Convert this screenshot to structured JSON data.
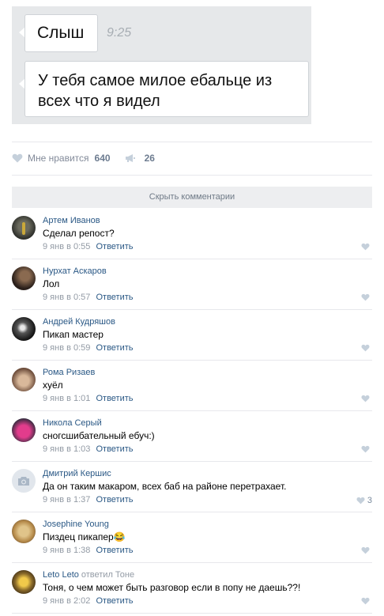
{
  "chat": {
    "message1": "Слыш",
    "time": "9:25",
    "message2_line1": "У тебя самое милое ебальце из",
    "message2_line2": "всех что я видел"
  },
  "post_actions": {
    "like_label": "Мне нравится",
    "like_count": "640",
    "share_count": "26"
  },
  "hide_comments_label": "Скрыть комментарии",
  "reply_label": "Ответить",
  "comments": [
    {
      "author": "Артем Иванов",
      "text": "Сделал репост?",
      "date": "9 янв в 0:55",
      "likes": ""
    },
    {
      "author": "Нурхат Аскаров",
      "text": "Лол",
      "date": "9 янв в 0:57",
      "likes": ""
    },
    {
      "author": "Андрей Кудряшов",
      "text": "Пикап мастер",
      "date": "9 янв в 0:59",
      "likes": ""
    },
    {
      "author": "Рома Ризаев",
      "text": "хуёл",
      "date": "9 янв в 1:01",
      "likes": ""
    },
    {
      "author": "Никола Серый",
      "text": "сногсшибательный ебуч:)",
      "date": "9 янв в 1:03",
      "likes": ""
    },
    {
      "author": "Дмитрий Кершис",
      "text": "Да он таким макаром, всех баб на районе перетрахает.",
      "date": "9 янв в 1:37",
      "likes": "3"
    },
    {
      "author": "Josephine Young",
      "text": "Пиздец пикапер😂",
      "date": "9 янв в 1:38",
      "likes": ""
    },
    {
      "author": "Leto Leto",
      "replied_to": "ответил Тоне",
      "text": "Тоня, о чем может быть разговор если в попу не даешь??!",
      "date": "9 янв в 2:02",
      "likes": ""
    }
  ],
  "colors": {
    "link": "#2a5885",
    "meta": "#939ba5",
    "chat_bg": "#e6e8ea",
    "bar_bg": "#edeef0"
  },
  "icons": [
    "heart-icon",
    "megaphone-icon",
    "camera-icon"
  ]
}
